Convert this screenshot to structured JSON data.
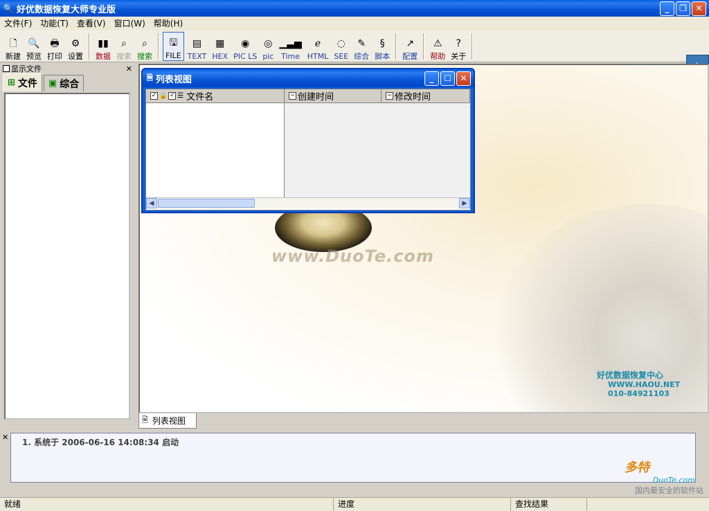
{
  "window": {
    "title": "好优数据恢复大师专业版"
  },
  "menu": [
    "文件(F)",
    "功能(T)",
    "查看(V)",
    "窗口(W)",
    "帮助(H)"
  ],
  "toolbar": [
    {
      "label": "新建",
      "icon": "new-icon"
    },
    {
      "label": "预览",
      "icon": "preview-icon"
    },
    {
      "label": "打印",
      "icon": "print-icon"
    },
    {
      "label": "设置",
      "icon": "settings-icon"
    },
    {
      "label": "数据",
      "icon": "data-icon"
    },
    {
      "label": "搜索",
      "icon": "search-gray-icon"
    },
    {
      "label": "搜索",
      "icon": "search-icon"
    },
    {
      "label": "FILE",
      "icon": "file-icon"
    },
    {
      "label": "TEXT",
      "icon": "text-icon"
    },
    {
      "label": "HEX",
      "icon": "hex-icon"
    },
    {
      "label": "PIC LS",
      "icon": "pic-ls-icon"
    },
    {
      "label": "pic",
      "icon": "pic-icon"
    },
    {
      "label": "Time",
      "icon": "time-icon"
    },
    {
      "label": "HTML",
      "icon": "html-icon"
    },
    {
      "label": "SEE",
      "icon": "see-icon"
    },
    {
      "label": "综合",
      "icon": "combine-icon"
    },
    {
      "label": "脚本",
      "icon": "script-icon"
    },
    {
      "label": "配置",
      "icon": "config-icon"
    },
    {
      "label": "帮助",
      "icon": "help-icon"
    },
    {
      "label": "关于",
      "icon": "about-icon"
    }
  ],
  "left_panel": {
    "header": "显示文件",
    "tabs": [
      "文件",
      "综合"
    ]
  },
  "list_view": {
    "title": "列表视图",
    "columns": [
      "文件名",
      "创建时间",
      "修改时间"
    ]
  },
  "background": {
    "watermark": "www.DuoTe.com",
    "brand_line1": "好优数据恢复中心",
    "brand_line2": "WWW.HAOU.NET",
    "brand_line3": "010-84921103"
  },
  "main_tab": "列表视图",
  "log": [
    "1. 系统于 2006-06-16 14:08:34 启动"
  ],
  "credit": {
    "line1": "多特",
    "line2": "DuoTe.com",
    "line3": "国内最安全的软件站"
  },
  "status": {
    "ready": "就绪",
    "progress": "进度",
    "results": "查找结果"
  }
}
